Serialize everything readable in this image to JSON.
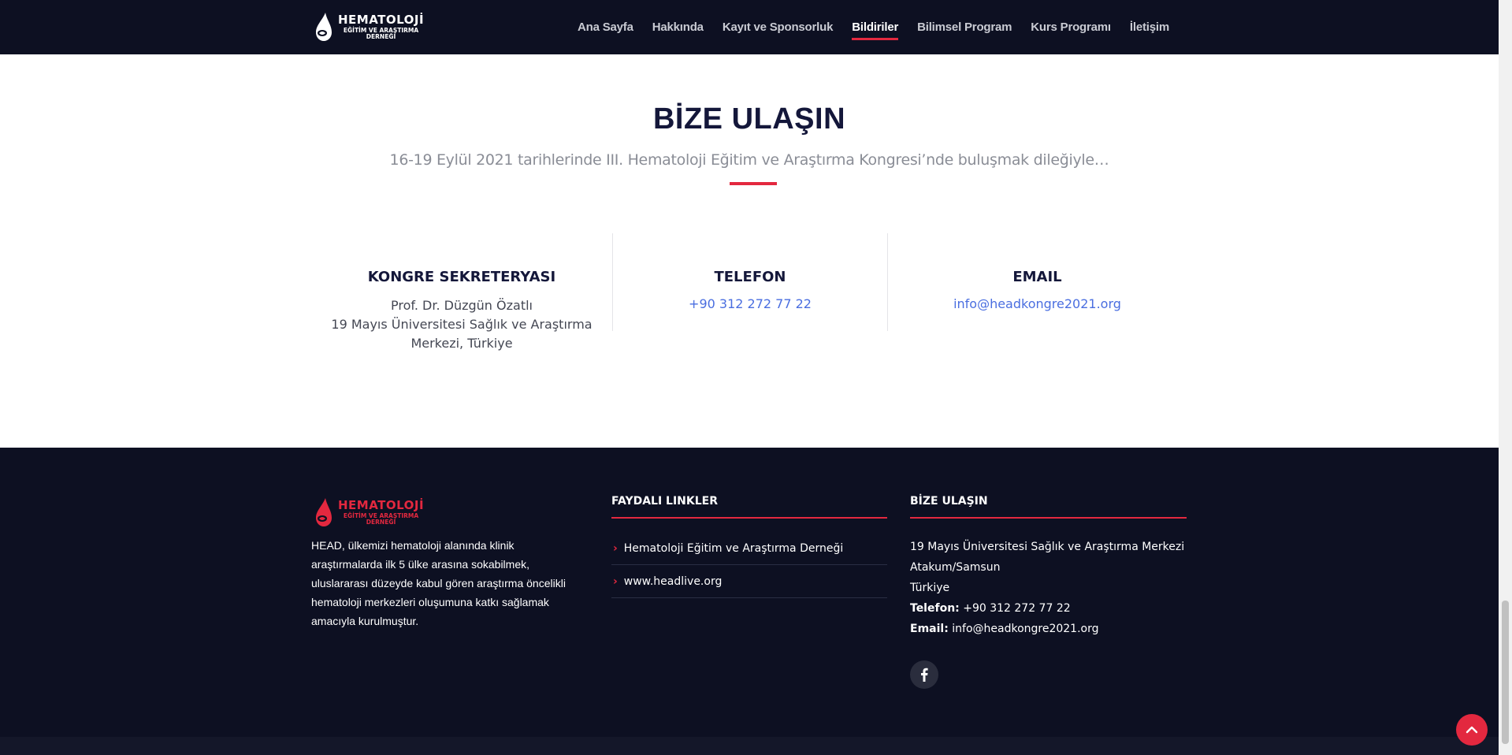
{
  "brand": {
    "name": "HEMATOLOJİ",
    "line2": "EĞİTİM VE ARAŞTIRMA",
    "line3": "DERNEĞİ"
  },
  "nav": {
    "items": [
      {
        "label": "Ana Sayfa"
      },
      {
        "label": "Hakkında"
      },
      {
        "label": "Kayıt ve Sponsorluk"
      },
      {
        "label": "Bildiriler"
      },
      {
        "label": "Bilimsel Program"
      },
      {
        "label": "Kurs Programı"
      },
      {
        "label": "İletişim"
      }
    ],
    "active_label": "Bildiriler"
  },
  "contact": {
    "title": "BİZE ULAŞIN",
    "subtitle": "16-19 Eylül 2021 tarihlerinde III. Hematoloji Eğitim ve Araştırma Kongresi’nde buluşmak dileğiyle…",
    "columns": [
      {
        "title": "KONGRE SEKRETERYASI",
        "line1": "Prof. Dr. Düzgün Özatlı",
        "line2": "19 Mayıs Üniversitesi Sağlık ve Araştırma",
        "line3": "Merkezi, Türkiye"
      },
      {
        "title": "TELEFON",
        "link": "+90 312 272 77 22"
      },
      {
        "title": "EMAIL",
        "link": "info@headkongre2021.org"
      }
    ]
  },
  "footer": {
    "about": "HEAD, ülkemizi hematoloji alanında klinik araştırmalarda ilk 5 ülke arasına sokabilmek, uluslararası düzeyde kabul gören araştırma öncelikli hematoloji merkezleri oluşumuna katkı sağlamak amacıyla kurulmuştur.",
    "links_title": "FAYDALI LINKLER",
    "links": [
      {
        "label": "Hematoloji Eğitim ve Araştırma Derneği"
      },
      {
        "label": "www.headlive.org"
      }
    ],
    "contact_title": "BİZE ULAŞIN",
    "address1": "19 Mayıs Üniversitesi Sağlık ve Araştırma Merkezi",
    "address2": "Atakum/Samsun",
    "address3": "Türkiye",
    "phone_label": "Telefon:",
    "phone": "+90 312 272 77 22",
    "email_label": "Email:",
    "email": "info@headkongre2021.org",
    "social_icon": "facebook-icon"
  },
  "colors": {
    "navy": "#0d1022",
    "accent": "#e3283f",
    "link": "#4a6ee0"
  }
}
